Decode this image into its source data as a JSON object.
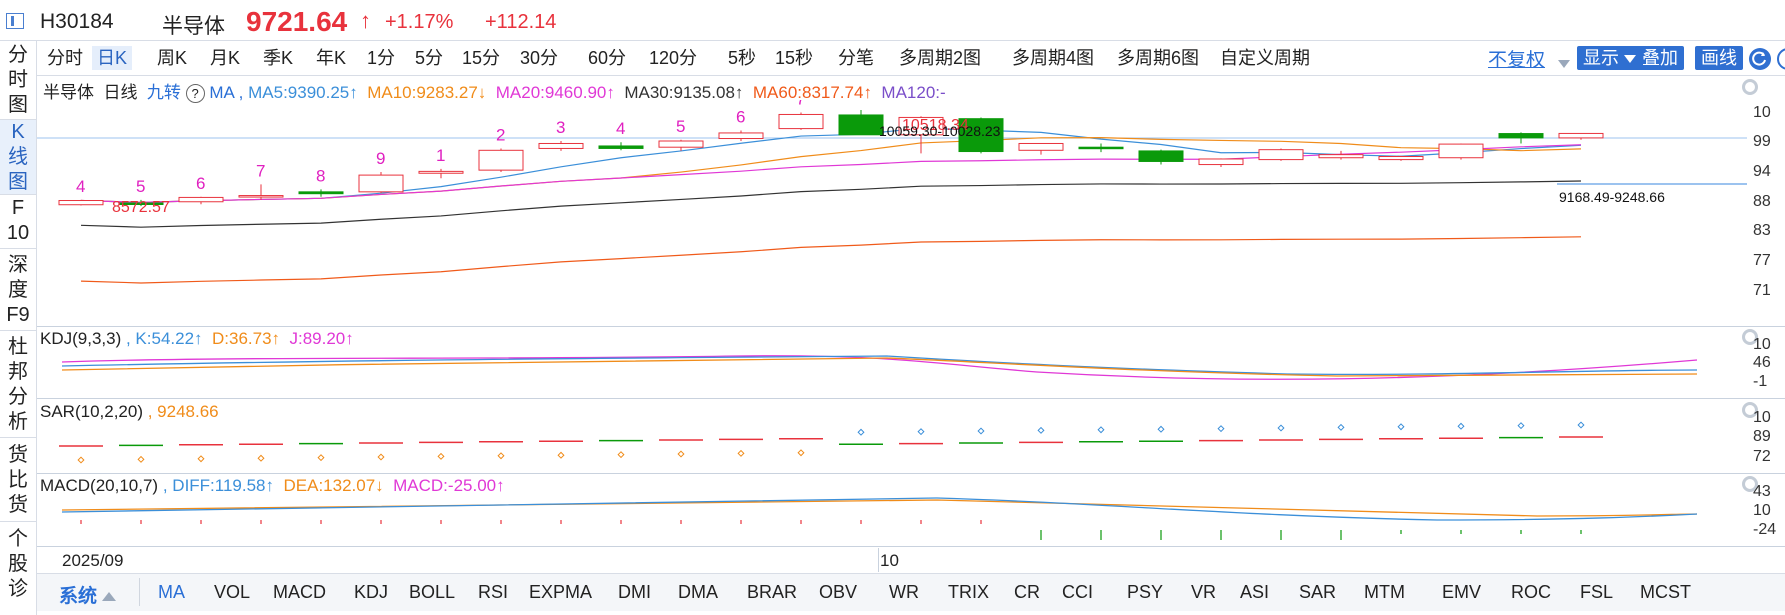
{
  "header": {
    "code": "H30184",
    "name": "半导体",
    "price": "9721.64",
    "pct_change": "+1.17%",
    "change": "+112.14",
    "up_color": "#e8323c"
  },
  "left_nav": [
    "分",
    "时",
    "图",
    "K",
    "线",
    "图",
    "F",
    "10",
    "深",
    "度",
    "F9",
    "杜",
    "邦",
    "分",
    "析",
    "货",
    "比",
    "货",
    "个",
    "股",
    "诊"
  ],
  "period_tabs": [
    "分时",
    "日K",
    "周K",
    "月K",
    "季K",
    "年K",
    "1分",
    "5分",
    "15分",
    "30分",
    "60分",
    "120分",
    "5秒",
    "15秒",
    "分笔",
    "多周期2图",
    "多周期4图",
    "多周期6图",
    "自定义周期"
  ],
  "right_controls": {
    "fq": "不复权",
    "show": "显示",
    "overlay": "叠加",
    "draw": "画线"
  },
  "main_info": {
    "name": "半导体",
    "period": "日线",
    "nine": "九转",
    "help": "?",
    "ma": "MA ,",
    "ma5": "MA5:9390.25↑",
    "ma10": "MA10:9283.27↓",
    "ma20": "MA20:9460.90↑",
    "ma30": "MA30:9135.08↑",
    "ma60": "MA60:8317.74↑",
    "ma120": "MA120:-"
  },
  "kdj_info": {
    "title": "KDJ(9,3,3)",
    "k": ", K:54.22↑",
    "d": "D:36.73↑",
    "j": "J:89.20↑"
  },
  "sar_info": {
    "title": "SAR(10,2,20)",
    "val": ",  9248.66"
  },
  "macd_info": {
    "title": "MACD(20,10,7)",
    "diff": ", DIFF:119.58↑",
    "dea": "DEA:132.07↓",
    "macd": "MACD:-25.00↑"
  },
  "axes": {
    "main_y": [
      "10",
      "99",
      "94",
      "88",
      "83",
      "77",
      "71"
    ],
    "kdj_y": [
      "10",
      "46",
      "-1"
    ],
    "sar_y": [
      "10",
      "89",
      "72"
    ],
    "macd_y": [
      "43",
      "10",
      "-24"
    ]
  },
  "date_axis": [
    "2025/09",
    "10"
  ],
  "annotations": {
    "low_label": "8572.57",
    "high_label": "10059.30-10028.23",
    "high_label_red": "10518.34",
    "range_label": "9168.49-9248.66",
    "nine_counts": [
      "4",
      "5",
      "6",
      "7",
      "8",
      "9",
      "1",
      "2",
      "3",
      "4",
      "5",
      "6",
      "7"
    ]
  },
  "bottom_tabs": {
    "system": "系统",
    "items": [
      "MA",
      "VOL",
      "MACD",
      "KDJ",
      "BOLL",
      "RSI",
      "EXPMA",
      "DMI",
      "DMA",
      "BRAR",
      "OBV",
      "WR",
      "TRIX",
      "CR",
      "CCI",
      "PSY",
      "VR",
      "ASI",
      "SAR",
      "MTM",
      "EMV",
      "ROC",
      "FSL",
      "MCST"
    ]
  },
  "colors": {
    "up": "#e8323c",
    "down": "#0a9a0a",
    "ma5": "#3b8fd9",
    "ma10": "#f08c1a",
    "ma20": "#e038d6",
    "ma30": "#333333",
    "ma60": "#f05a1a",
    "ma120": "#7a4ec9",
    "magenta": "#e020c0",
    "blue": "#2a6fd6"
  },
  "chart_data": {
    "type": "candlestick",
    "x": [
      "2025/09",
      "",
      "",
      "",
      "",
      "",
      "",
      "",
      "",
      "",
      "",
      "10",
      "",
      "",
      "",
      "",
      "",
      "",
      "",
      "",
      "",
      "",
      "",
      "",
      "",
      ""
    ],
    "ohlc": [
      [
        8572,
        8650,
        8560,
        8640
      ],
      [
        8600,
        8650,
        8550,
        8580
      ],
      [
        8620,
        8700,
        8580,
        8690
      ],
      [
        8700,
        8900,
        8650,
        8720
      ],
      [
        8780,
        8820,
        8700,
        8750
      ],
      [
        8780,
        9100,
        8760,
        9050
      ],
      [
        9080,
        9150,
        9000,
        9110
      ],
      [
        9130,
        9480,
        9100,
        9450
      ],
      [
        9480,
        9600,
        9440,
        9560
      ],
      [
        9520,
        9580,
        9450,
        9480
      ],
      [
        9500,
        9620,
        9440,
        9600
      ],
      [
        9640,
        9770,
        9600,
        9730
      ],
      [
        9800,
        10059,
        9780,
        10028
      ],
      [
        10020,
        10100,
        9700,
        9700
      ],
      [
        9700,
        10000,
        9400,
        9980
      ],
      [
        9960,
        9980,
        9400,
        9430
      ],
      [
        9450,
        9560,
        9380,
        9560
      ],
      [
        9500,
        9560,
        9420,
        9480
      ],
      [
        9440,
        9460,
        9220,
        9270
      ],
      [
        9220,
        9320,
        9180,
        9310
      ],
      [
        9300,
        9480,
        9280,
        9460
      ],
      [
        9330,
        9440,
        9300,
        9380
      ],
      [
        9300,
        9360,
        9280,
        9350
      ],
      [
        9330,
        9560,
        9300,
        9550
      ],
      [
        9720,
        9740,
        9560,
        9650
      ],
      [
        9650,
        9720,
        9620,
        9722
      ]
    ],
    "ylim": [
      7100,
      10100
    ]
  }
}
